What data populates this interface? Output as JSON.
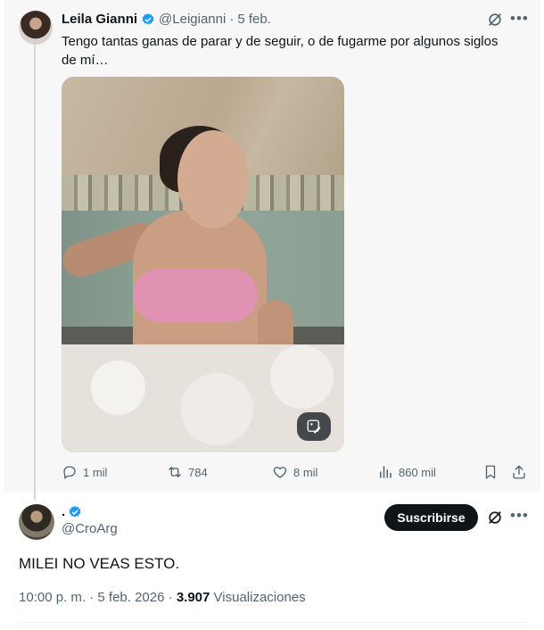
{
  "quoted_post": {
    "author_name": "Leila Gianni",
    "author_handle": "@Leigianni",
    "separator": "·",
    "date": "5 feb.",
    "text": "Tengo tantas ganas de parar y de seguir, o de fugarme por algunos siglos de mí…",
    "actions": {
      "replies": "1 mil",
      "reposts": "784",
      "likes": "8 mil",
      "views": "860 mil"
    }
  },
  "main_post": {
    "author_name": ".",
    "author_handle": "@CroArg",
    "subscribe_label": "Suscribirse",
    "text": "MILEI NO VEAS ESTO.",
    "time": "10:00 p. m.",
    "date": "5 feb. 2026",
    "separator": "·",
    "views_count": "3.907",
    "views_label": "Visualizaciones"
  },
  "colors": {
    "verified": "#1d9bf0",
    "text_primary": "#0f1419",
    "text_secondary": "#536471",
    "subscribe_bg": "#0f1419"
  },
  "icons": [
    "verified-badge-icon",
    "grok-icon",
    "more-icon",
    "reply-icon",
    "repost-icon",
    "like-icon",
    "views-icon",
    "bookmark-icon",
    "share-icon",
    "edit-image-icon"
  ]
}
